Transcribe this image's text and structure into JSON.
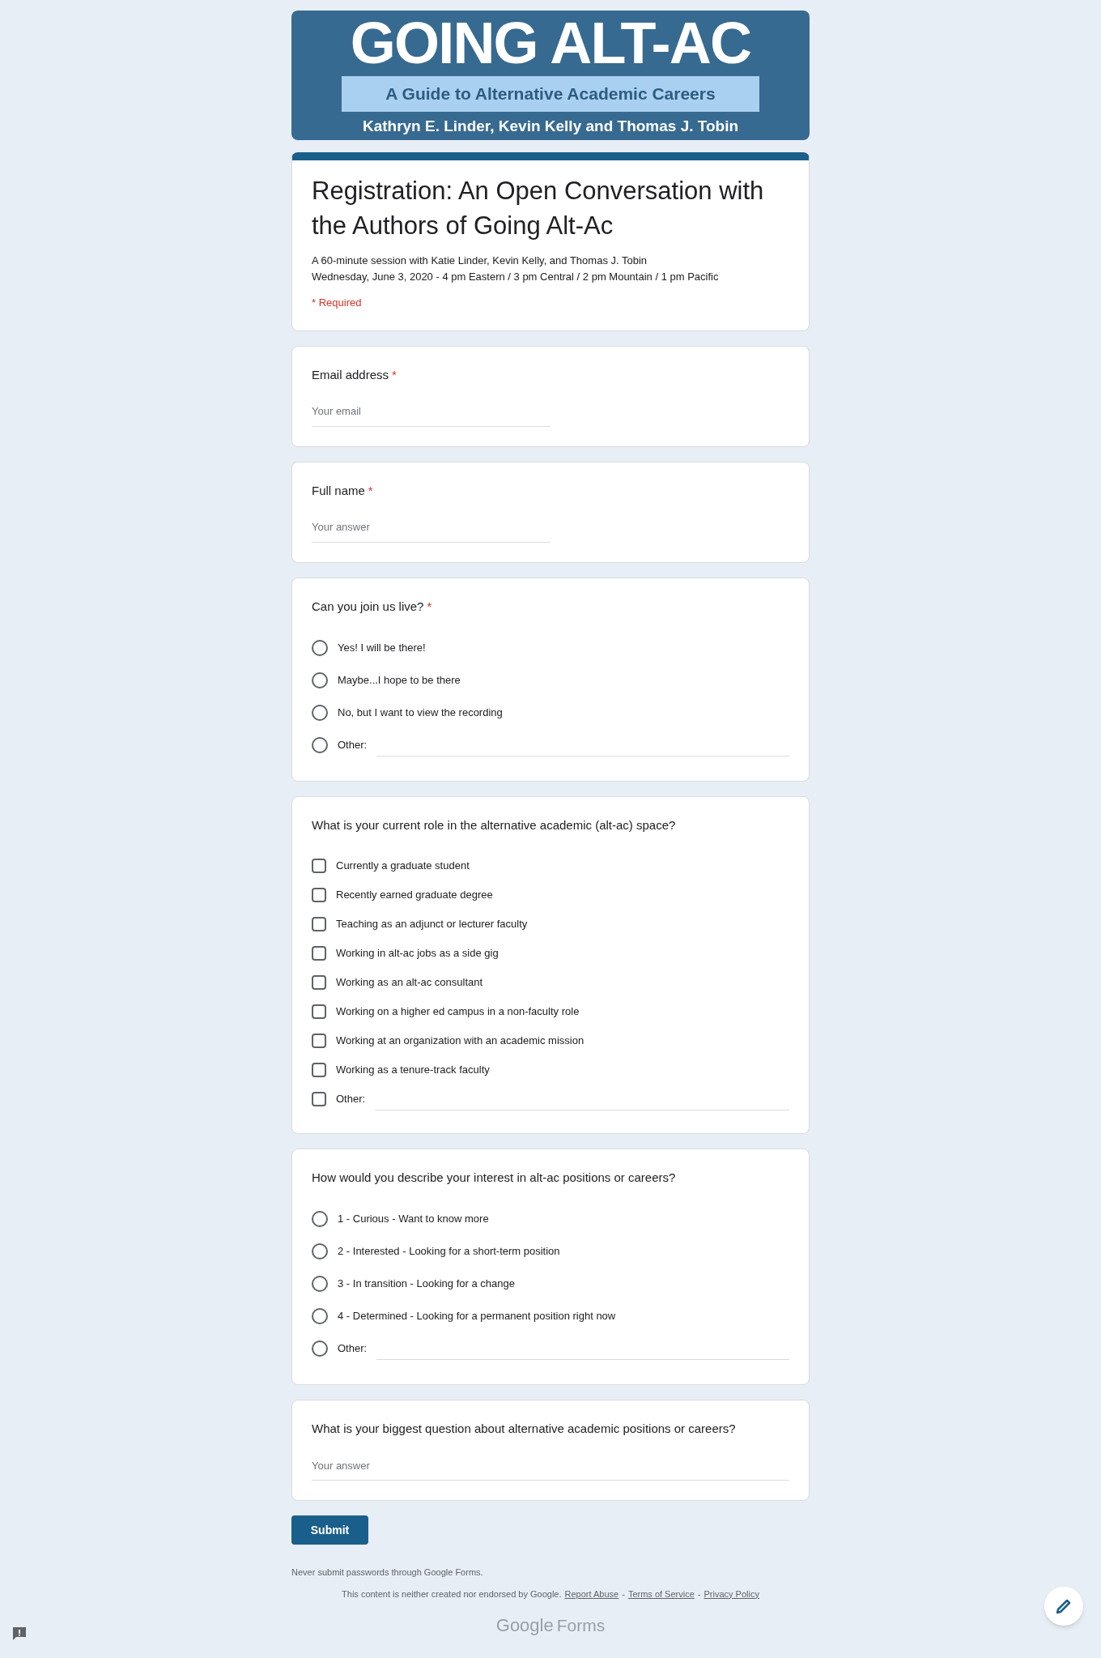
{
  "banner": {
    "title": "GOING ALT-AC",
    "subtitle": "A Guide to Alternative Academic Careers",
    "authors": "Kathryn E. Linder, Kevin Kelly and Thomas J. Tobin"
  },
  "form": {
    "title": "Registration: An Open Conversation with the Authors of Going Alt-Ac",
    "description": [
      "A 60-minute session with Katie Linder, Kevin Kelly, and Thomas J. Tobin",
      "Wednesday, June 3, 2020 - 4 pm Eastern / 3 pm Central / 2 pm Mountain / 1 pm Pacific"
    ],
    "required_note": "* Required"
  },
  "questions": [
    {
      "kind": "text",
      "label": "Email address",
      "required_mark": "*",
      "placeholder": "Your email",
      "wide": false
    },
    {
      "kind": "text",
      "label": "Full name",
      "required_mark": "*",
      "placeholder": "Your answer",
      "wide": false
    },
    {
      "kind": "radio",
      "label": "Can you join us live?",
      "required_mark": "*",
      "options": [
        {
          "label": "Yes! I will be there!",
          "selected": false
        },
        {
          "label": "Maybe...I hope to be there",
          "selected": false
        },
        {
          "label": "No, but I want to view the recording",
          "selected": false
        },
        {
          "label": "Other:",
          "selected": false,
          "other": true
        }
      ]
    },
    {
      "kind": "checkbox",
      "label": "What is your current role in the alternative academic (alt-ac) space?",
      "options": [
        {
          "label": "Currently a graduate student",
          "checked": false
        },
        {
          "label": "Recently earned graduate degree",
          "checked": false
        },
        {
          "label": "Teaching as an adjunct or lecturer faculty",
          "checked": false
        },
        {
          "label": "Working in alt-ac jobs as a side gig",
          "checked": false
        },
        {
          "label": "Working as an alt-ac consultant",
          "checked": false
        },
        {
          "label": "Working on a higher ed campus in a non-faculty role",
          "checked": false
        },
        {
          "label": "Working at an organization with an academic mission",
          "checked": false
        },
        {
          "label": "Working as a tenure-track faculty",
          "checked": false
        },
        {
          "label": "Other:",
          "checked": false,
          "other": true
        }
      ]
    },
    {
      "kind": "radio",
      "label": "How would you describe your interest in alt-ac positions or careers?",
      "options": [
        {
          "label": "1 - Curious - Want to know more",
          "selected": false
        },
        {
          "label": "2 - Interested - Looking for a short-term position",
          "selected": false
        },
        {
          "label": "3 - In transition - Looking for a change",
          "selected": false
        },
        {
          "label": "4 - Determined - Looking for a permanent position right now",
          "selected": false
        },
        {
          "label": "Other:",
          "selected": false,
          "other": true
        }
      ]
    },
    {
      "kind": "text",
      "label": "What is your biggest question about alternative academic positions or careers?",
      "placeholder": "Your answer",
      "wide": true
    }
  ],
  "submit": "Submit",
  "footer": {
    "warning": "Never submit passwords through Google Forms.",
    "disclaimer": "This content is neither created nor endorsed by Google.",
    "links": [
      "Report Abuse",
      "Terms of Service",
      "Privacy Policy"
    ],
    "separator": "-",
    "logo_google": "Google",
    "logo_forms": "Forms"
  }
}
